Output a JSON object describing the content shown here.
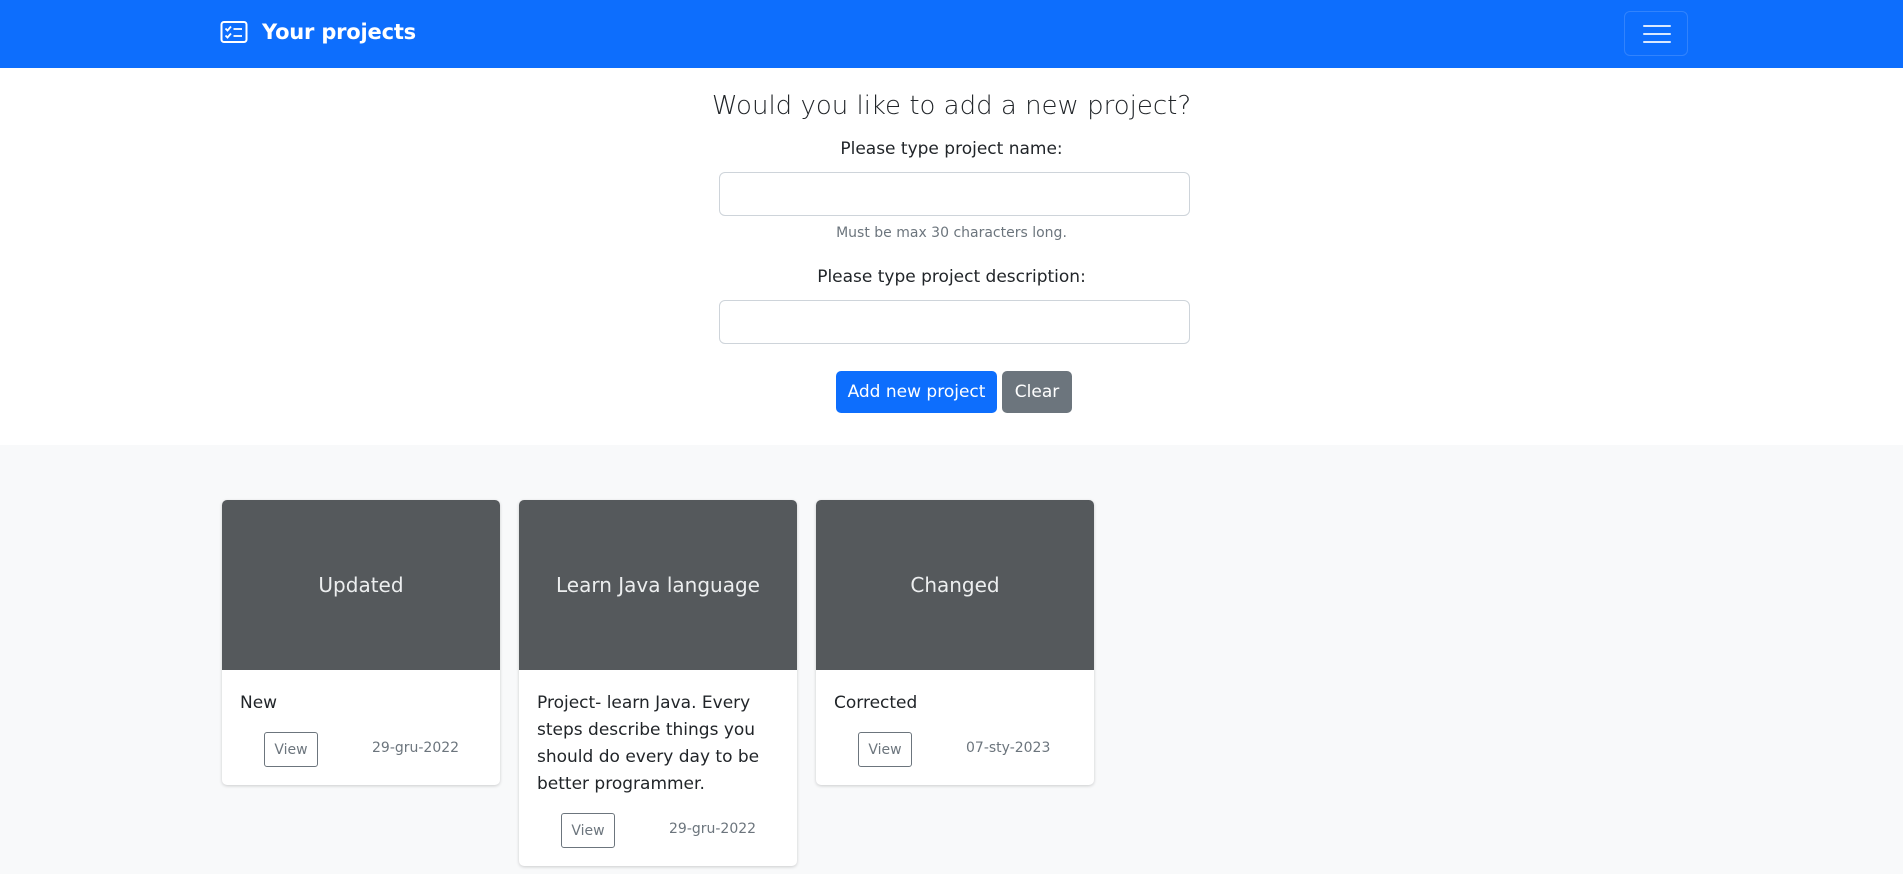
{
  "navbar": {
    "brand": "Your projects",
    "brand_icon": "card-checklist-icon",
    "toggle_icon": "hamburger-menu-icon",
    "color": "#0d6efd"
  },
  "form": {
    "title": "Would you like to add a new project?",
    "name_label": "Please type project name:",
    "name_value": "",
    "name_help": "Must be max 30 characters long.",
    "description_label": "Please type project description:",
    "description_value": "",
    "add_button": "Add new project",
    "clear_button": "Clear"
  },
  "projects": [
    {
      "title": "Updated",
      "description": "New",
      "view_label": "View",
      "date": "29-gru-2022"
    },
    {
      "title": "Learn Java language",
      "description": "Project- learn Java. Every steps describe things you should do every day to be better programmer.",
      "view_label": "View",
      "date": "29-gru-2022"
    },
    {
      "title": "Changed",
      "description": "Corrected",
      "view_label": "View",
      "date": "07-sty-2023"
    }
  ]
}
